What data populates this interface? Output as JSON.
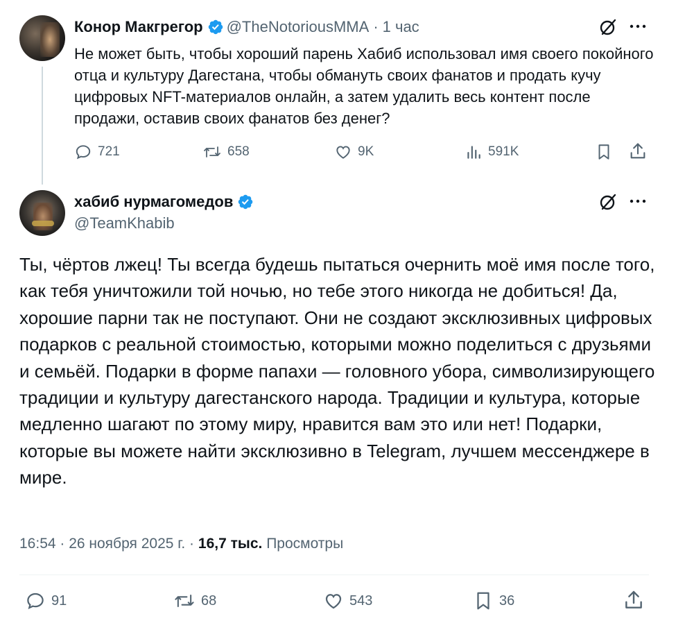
{
  "tweet1": {
    "author_name": "Конор Макгрегор",
    "handle": "@TheNotoriousMMA",
    "time": "1 час",
    "separator": "·",
    "text": "Не может быть, чтобы хороший парень Хабиб использовал имя своего покойного отца и культуру Дагестана, чтобы обмануть своих фанатов и продать кучу цифровых NFT-материалов онлайн, а затем удалить весь контент после продажи, оставив своих фанатов без денег?",
    "actions": {
      "replies": "721",
      "reposts": "658",
      "likes": "9K",
      "views": "591K"
    }
  },
  "tweet2": {
    "author_name": "хабиб нурмагомедов",
    "handle": "@TeamKhabib",
    "text": "Ты, чёртов лжец! Ты всегда будешь пытаться очернить моё имя после того, как тебя уничтожили той ночью, но тебе этого никогда не добиться! Да, хорошие парни так не поступают. Они не создают эксклюзивных цифровых подарков с реальной стоимостью, которыми можно поделиться с друзьями и семьёй. Подарки в форме папахи — головного убора, символизирующего традиции и культуру дагестанского народа. Традиции и культура, которые медленно шагают по этому миру, нравится вам это или нет! Подарки, которые вы можете найти эксклюзивно в Telegram, лучшем мессенджере в мире.",
    "timestamp": "16:54 · 26 ноября 2025 г. ·",
    "views_count": "16,7 тыс.",
    "views_label": "Просмотры",
    "actions": {
      "replies": "91",
      "reposts": "68",
      "likes": "543",
      "bookmarks": "36"
    }
  },
  "colors": {
    "verified": "#1d9bf0",
    "secondary_text": "#536471",
    "primary_text": "#0f1419"
  },
  "icons": [
    "verified-badge-icon",
    "grok-icon",
    "more-icon",
    "reply-icon",
    "repost-icon",
    "like-icon",
    "views-icon",
    "bookmark-icon",
    "share-icon"
  ]
}
